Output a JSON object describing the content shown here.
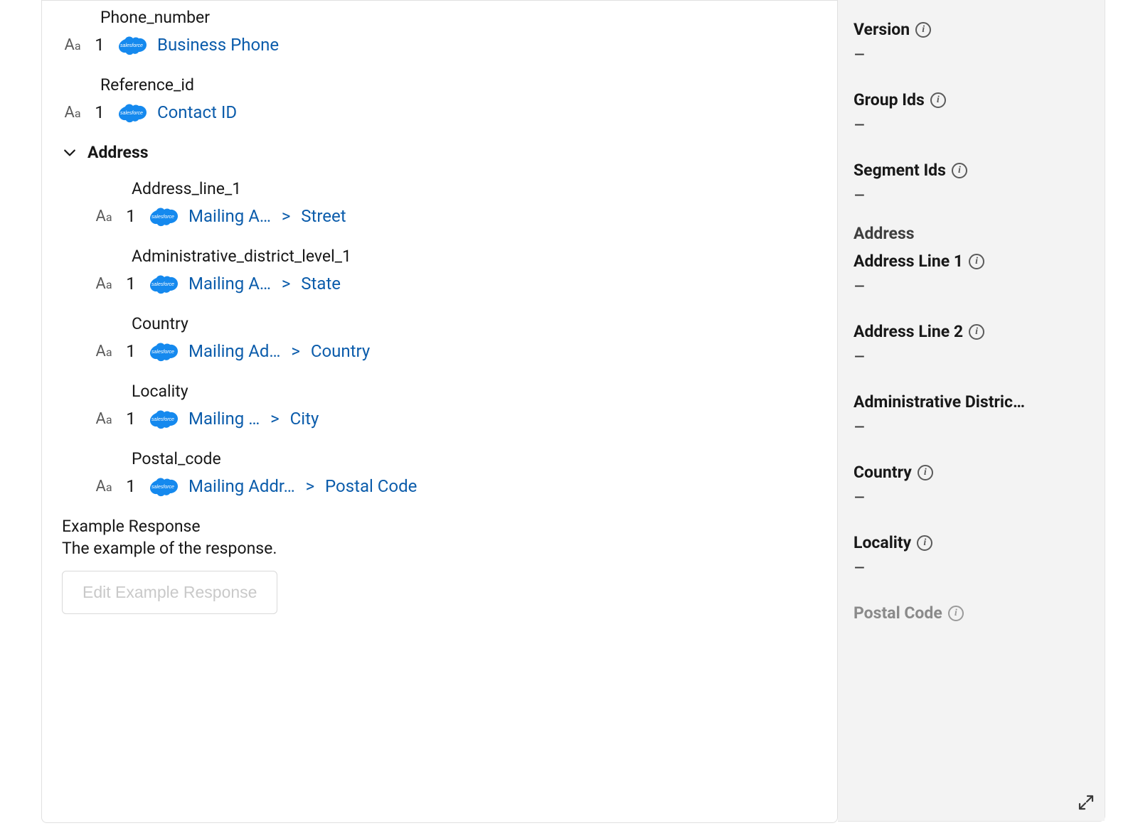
{
  "fields": [
    {
      "label": "Phone_number",
      "count": "1",
      "mapping_a": "Business Phone",
      "mapping_b": null
    },
    {
      "label": "Reference_id",
      "count": "1",
      "mapping_a": "Contact ID",
      "mapping_b": null
    }
  ],
  "address_section": {
    "title": "Address",
    "items": [
      {
        "label": "Address_line_1",
        "count": "1",
        "mapping_a": "Mailing A…",
        "mapping_b": "Street"
      },
      {
        "label": "Administrative_district_level_1",
        "count": "1",
        "mapping_a": "Mailing A…",
        "mapping_b": "State"
      },
      {
        "label": "Country",
        "count": "1",
        "mapping_a": "Mailing Ad…",
        "mapping_b": "Country"
      },
      {
        "label": "Locality",
        "count": "1",
        "mapping_a": "Mailing …",
        "mapping_b": "City"
      },
      {
        "label": "Postal_code",
        "count": "1",
        "mapping_a": "Mailing Addr…",
        "mapping_b": "Postal Code"
      }
    ]
  },
  "example": {
    "label": "Example Response",
    "desc": "The example of the response.",
    "button": "Edit Example Response"
  },
  "side": {
    "version": {
      "label": "Version",
      "value": "–"
    },
    "group_ids": {
      "label": "Group Ids",
      "value": "–"
    },
    "segment_ids": {
      "label": "Segment Ids",
      "value": "–"
    },
    "address_header": "Address",
    "addr1": {
      "label": "Address Line 1",
      "value": "–"
    },
    "addr2": {
      "label": "Address Line 2",
      "value": "–"
    },
    "admin": {
      "label": "Administrative Distric…",
      "value": "–"
    },
    "country": {
      "label": "Country",
      "value": "–"
    },
    "locality": {
      "label": "Locality",
      "value": "–"
    },
    "postal": {
      "label": "Postal Code",
      "value": ""
    }
  }
}
